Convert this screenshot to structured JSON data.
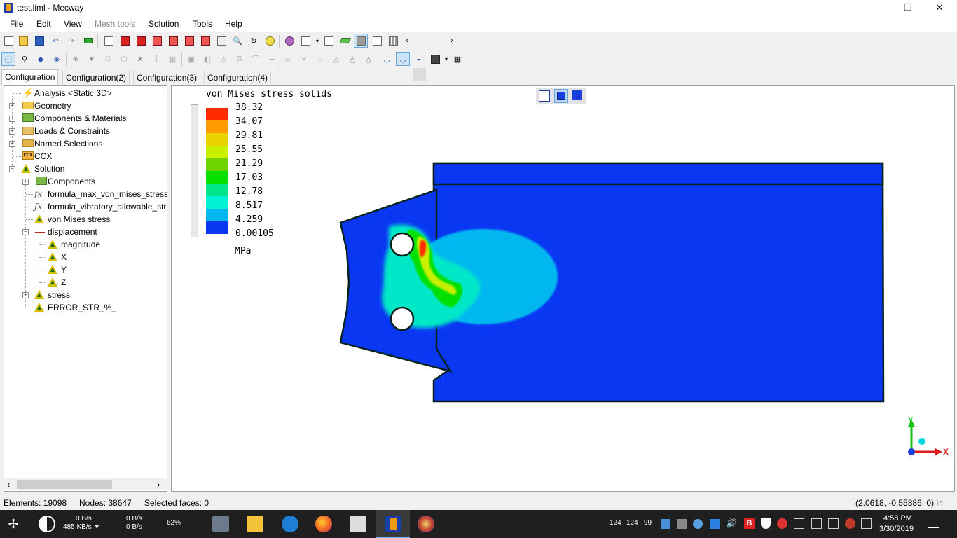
{
  "window": {
    "title": "test.liml - Mecway",
    "minimize": "—",
    "restore": "❐",
    "close": "✕"
  },
  "menu": [
    "File",
    "Edit",
    "View",
    "Mesh tools",
    "Solution",
    "Tools",
    "Help"
  ],
  "menu_disabled": [
    "Mesh tools"
  ],
  "toolbar1_icons": [
    "new-file-icon",
    "open-folder-icon",
    "save-icon",
    "undo-icon",
    "redo-icon",
    "green-bars-icon",
    "view-iso-icon",
    "view-front-icon",
    "view-back-icon",
    "view-left-icon",
    "view-right-icon",
    "view-top-icon",
    "zoom-box-icon",
    "zoom-icon",
    "rotate-icon",
    "pan-icon",
    "fit-icon",
    "show-hide-icon",
    "filter-icon",
    "display-surface-icon",
    "solid-view-icon",
    "wireframe-view-icon",
    "mesh-view-icon"
  ],
  "toolbar2_icons": [
    "select-icon",
    "select-node-icon",
    "select-face-icon",
    "select-element-icon",
    "explode-icon",
    "box-icon",
    "hidden-box-icon",
    "cross-icon",
    "split-icon",
    "refine-icon",
    "extrude-icon",
    "revolve-icon",
    "mirror-icon",
    "copy-icon",
    "fillet-icon",
    "sweep-icon",
    "loft-icon",
    "branch-icon",
    "scatter-icon",
    "triangle-mesh-icon",
    "triangle-outline-icon",
    "deform-icon",
    "deform-scale-icon",
    "animate-icon",
    "film-icon",
    "table-icon"
  ],
  "tabs": [
    "Configuration",
    "Configuration(2)",
    "Configuration(3)",
    "Configuration(4)"
  ],
  "tree": {
    "items": [
      {
        "label": "Analysis <Static 3D>"
      },
      {
        "label": "Geometry"
      },
      {
        "label": "Components & Materials"
      },
      {
        "label": "Loads & Constraints"
      },
      {
        "label": "Named Selections"
      },
      {
        "label": "CCX"
      },
      {
        "label": "Solution"
      },
      {
        "label": "Components"
      },
      {
        "label": "formula_max_von_mises_stress_"
      },
      {
        "label": "formula_vibratory_allowable_str"
      },
      {
        "label": "von Mises stress"
      },
      {
        "label": "displacement"
      },
      {
        "label": "magnitude"
      },
      {
        "label": "X"
      },
      {
        "label": "Y"
      },
      {
        "label": "Z"
      },
      {
        "label": "stress"
      },
      {
        "label": "ERROR_STR_%_"
      }
    ],
    "ccx_badge": "CCX",
    "fx_glyph": "ƒx",
    "scroll_left": "‹",
    "scroll_right": "›"
  },
  "legend": {
    "title": "von Mises stress solids",
    "values": [
      "38.32",
      "34.07",
      "29.81",
      "25.55",
      "21.29",
      "17.03",
      "12.78",
      "8.517",
      "4.259",
      "0.00105"
    ],
    "colors": [
      "#ff2a00",
      "#ff9d00",
      "#e8d200",
      "#c8f000",
      "#6ed300",
      "#05e000",
      "#00e58a",
      "#00f0d6",
      "#00b7f0",
      "#0a37f2"
    ],
    "unit": "MPa"
  },
  "axes": {
    "x": "X",
    "y": "Y"
  },
  "status": {
    "elements": "Elements: 19098",
    "nodes": "Nodes: 38647",
    "selected": "Selected faces: 0",
    "coords": "(2.0618, -0.55886, 0) in"
  },
  "taskbar": {
    "net_up": "0 B/s",
    "net_down": "485 KB/s ▼",
    "disk_read": "0 B/s",
    "disk_write": "0 B/s",
    "cpu": "62%",
    "tray_num1": "124",
    "tray_num2": "124",
    "tray_num3": "99",
    "time": "4:58 PM",
    "date": "3/30/2019"
  }
}
